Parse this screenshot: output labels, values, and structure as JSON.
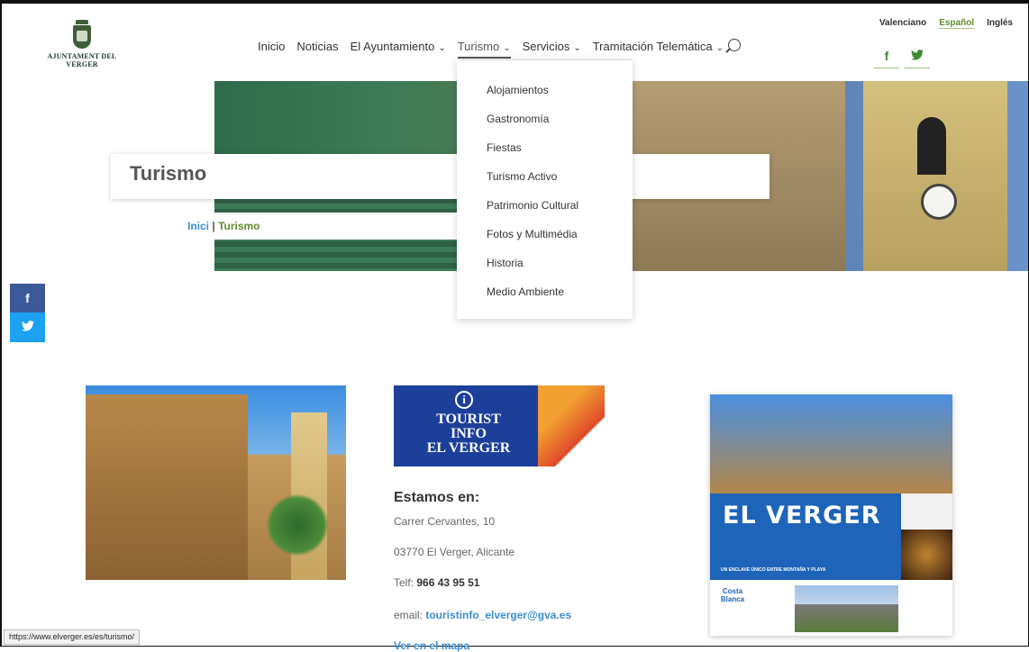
{
  "header": {
    "logo_text": "AJUNTAMENT DEL VERGER",
    "nav": [
      {
        "label": "Inicio",
        "has_menu": false
      },
      {
        "label": "Noticias",
        "has_menu": false
      },
      {
        "label": "El Ayuntamiento",
        "has_menu": true
      },
      {
        "label": "Turismo",
        "has_menu": true,
        "active": true
      },
      {
        "label": "Servicios",
        "has_menu": true
      },
      {
        "label": "Tramitación Telemática",
        "has_menu": true
      }
    ],
    "languages": [
      "Valenciano",
      "Español",
      "Inglés"
    ],
    "selected_language": "Español",
    "social": {
      "facebook": "f",
      "twitter": "twitter-icon"
    }
  },
  "dropdown": {
    "items": [
      "Alojamientos",
      "Gastronomía",
      "Fiestas",
      "Turismo Activo",
      "Patrimonio Cultural",
      "Fotos y Multimédia",
      "Historia",
      "Medio Ambiente"
    ]
  },
  "hero": {
    "title": "Turismo",
    "breadcrumb": {
      "home": "Inici",
      "separator": "|",
      "current": "Turismo"
    }
  },
  "side_social": {
    "facebook": "f",
    "twitter": "twitter-icon"
  },
  "info": {
    "tourist_logo": [
      "TOURIST",
      "INFO",
      "EL VERGER"
    ],
    "heading": "Estamos en:",
    "address": "Carrer Cervantes, 10",
    "city": "03770 El Verger, Alicante",
    "phone_label": "Telf:",
    "phone": "966 43 95 51",
    "email_label": "email:",
    "email": "touristinfo_elverger@gva.es",
    "map_link": "Ver en el mapa"
  },
  "poster": {
    "title": "EL VERGER",
    "subtitle": "UN ENCLAVE ÚNICO ENTRE MONTAÑA Y PLAYA",
    "brand": "Costa Blanca"
  },
  "status_bar": "https://www.elverger.es/es/turismo/",
  "colors": {
    "green": "#5d8e2e",
    "link_blue": "#3a8ed0",
    "facebook": "#3b5998",
    "twitter": "#1da1f2"
  }
}
